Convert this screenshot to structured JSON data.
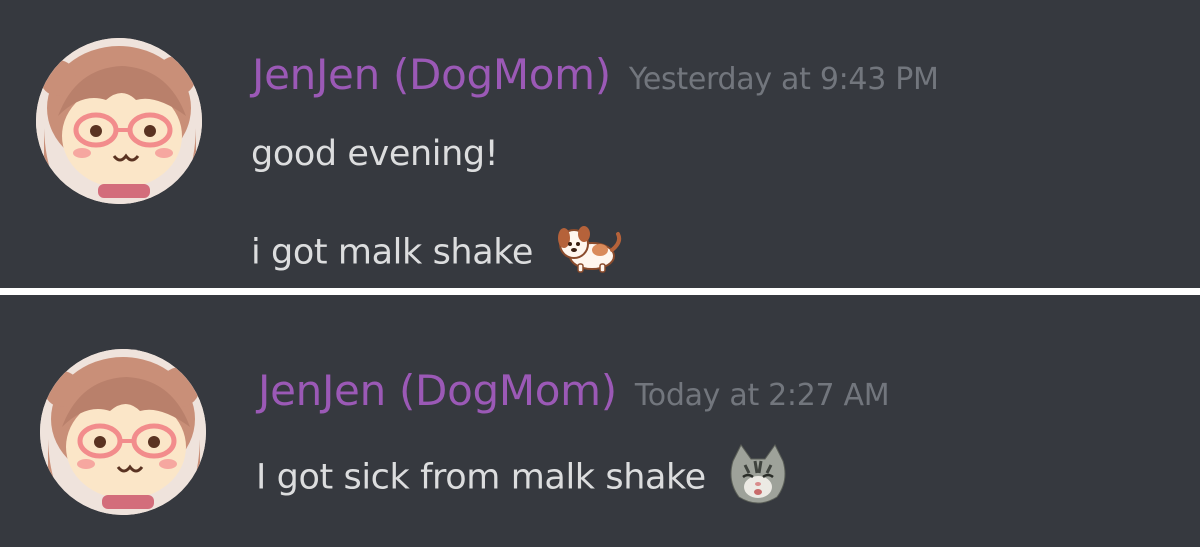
{
  "messages": [
    {
      "username": "JenJen (DogMom)",
      "timestamp": "Yesterday at 9:43 PM",
      "lines": [
        "good evening!",
        "i got malk shake"
      ],
      "emoji": "dog-emoji"
    },
    {
      "username": "JenJen (DogMom)",
      "timestamp": "Today at 2:27 AM",
      "lines": [
        "I got sick from malk shake"
      ],
      "emoji": "cat-emoji"
    }
  ],
  "colors": {
    "background": "#36393f",
    "username": "#9b59b6",
    "timestamp": "#72767d",
    "text": "#dcddde",
    "divider": "#ffffff"
  }
}
